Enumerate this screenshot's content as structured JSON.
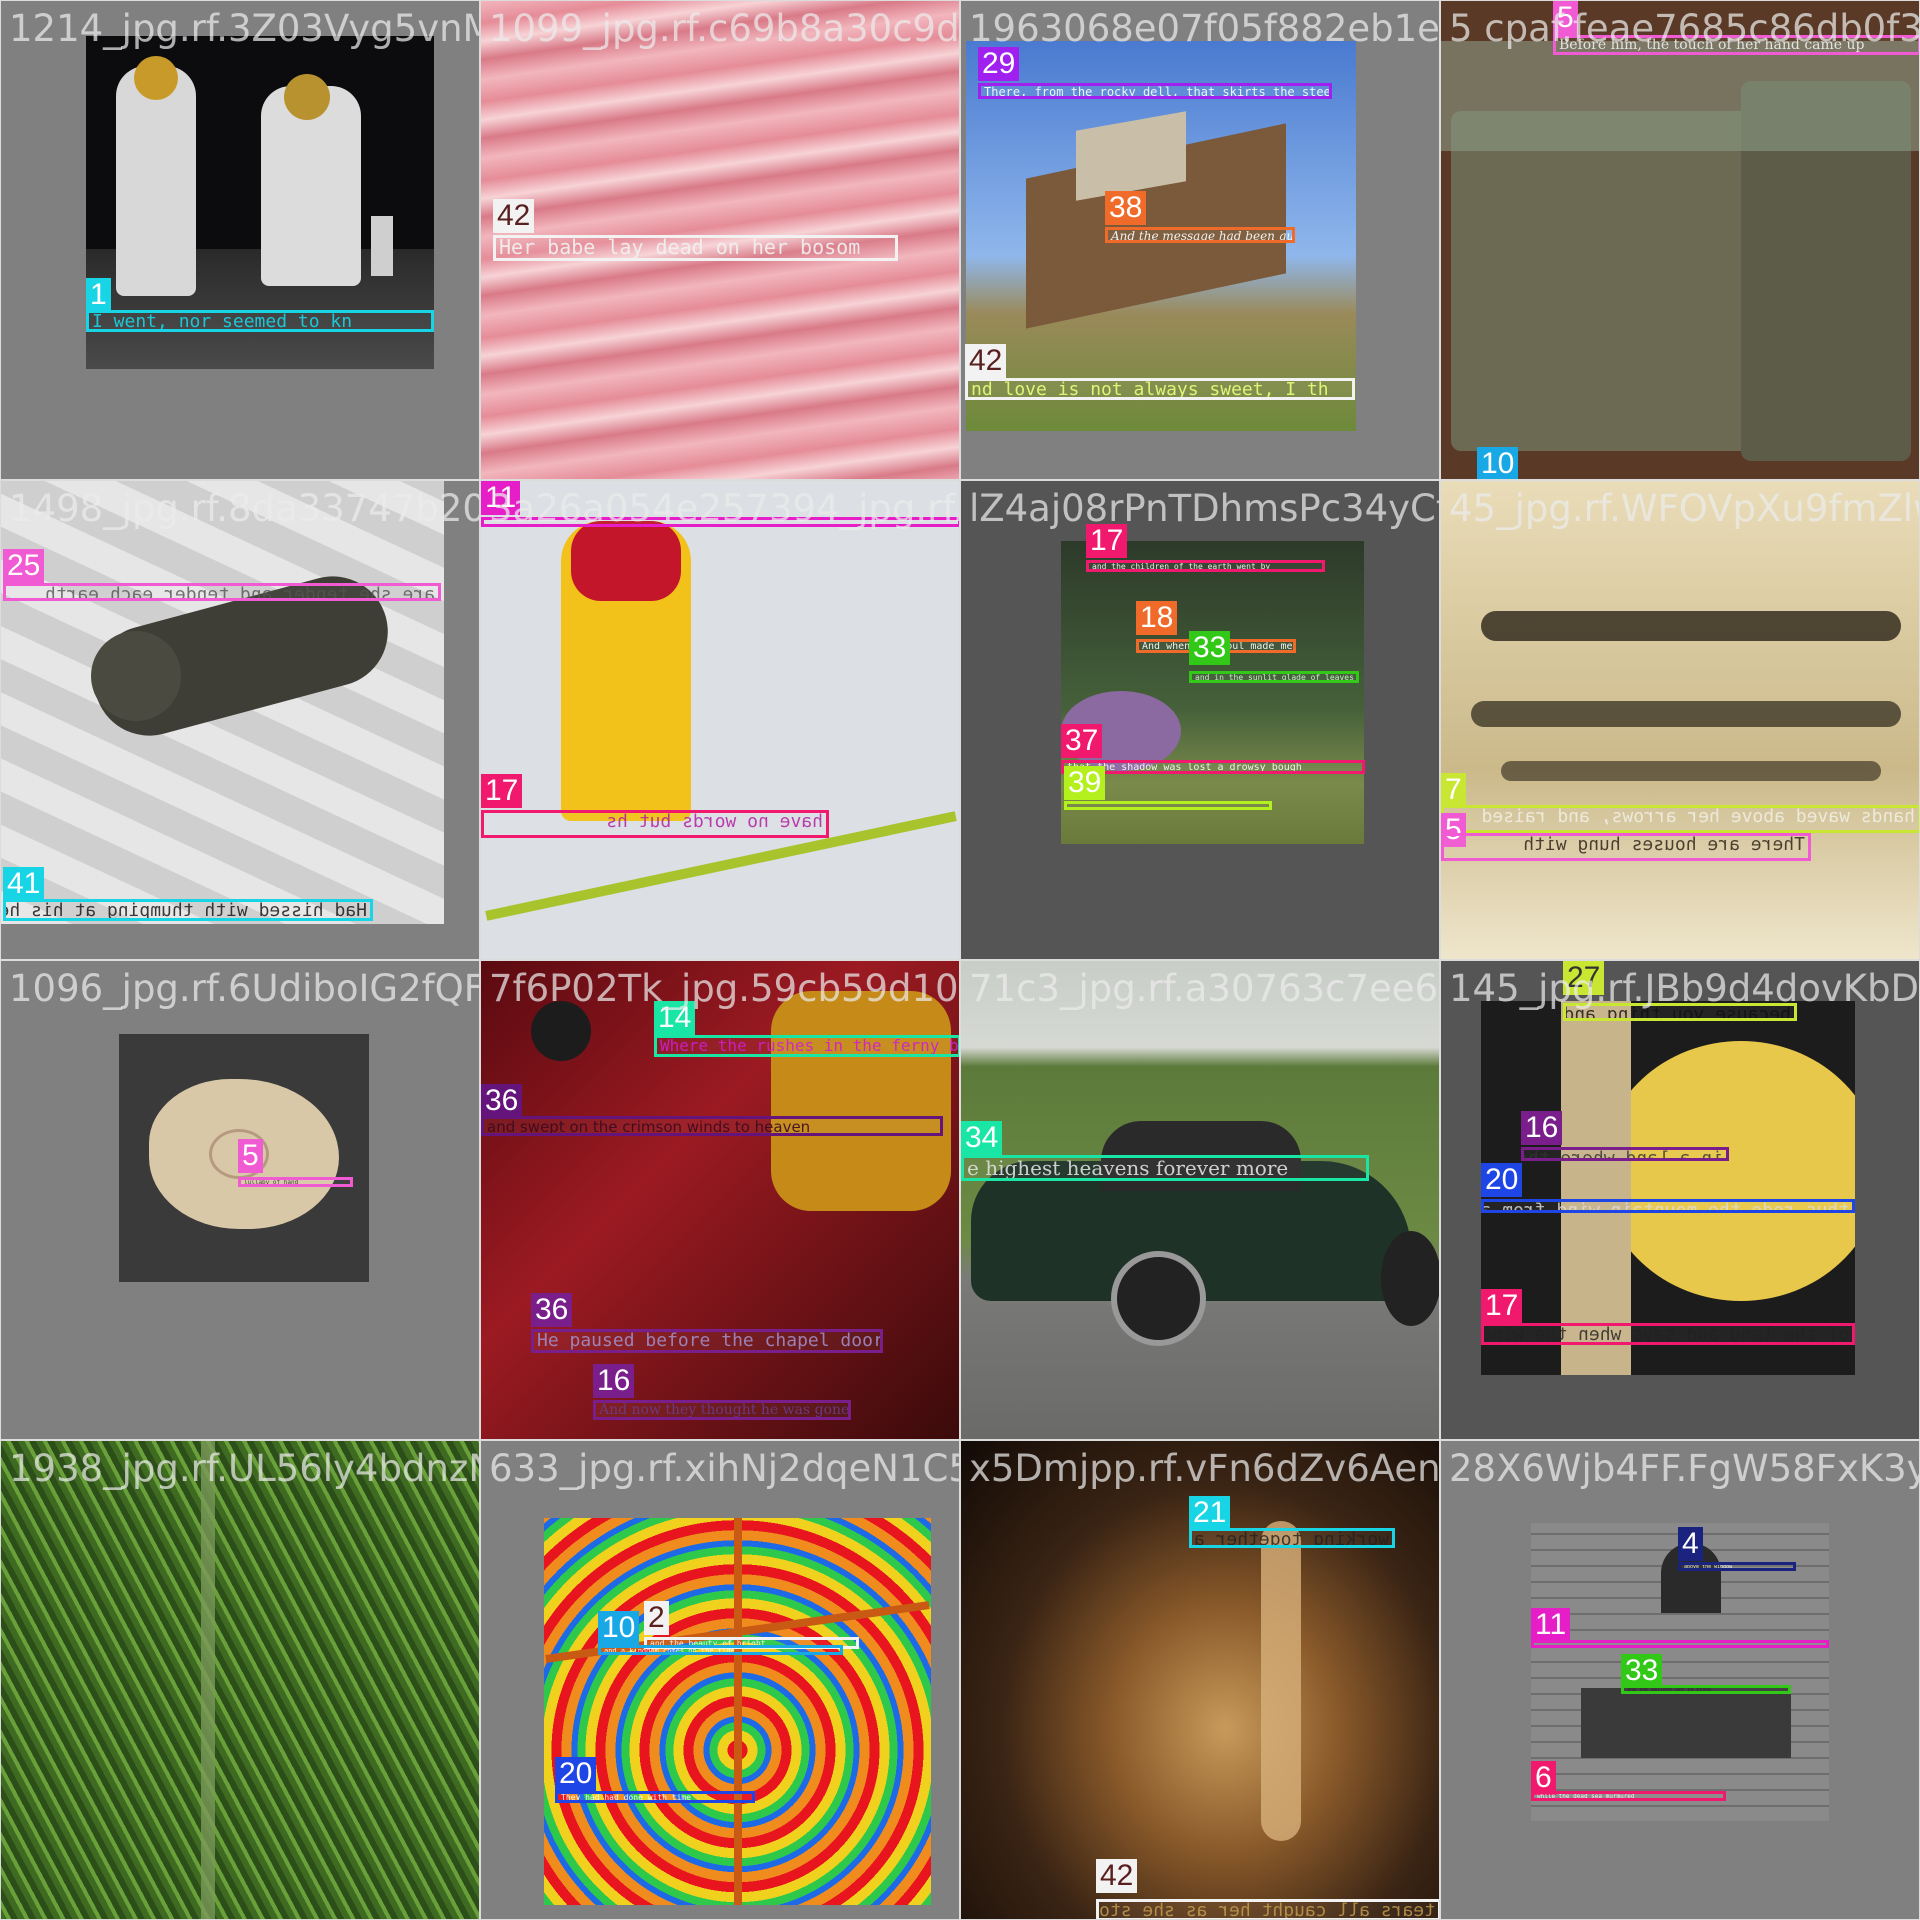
{
  "tiles": [
    {
      "filename": "1214_jpg.rf.3Z03Vyg5vnMOl0999Kipl_jpg",
      "labels": [
        {
          "id": "1",
          "color": "#18d5e6",
          "text": "I went, nor seemed to kn"
        }
      ]
    },
    {
      "filename": "1099_jpg.rf.c69b8a30c9dd0f1963068e07f05f882eb1ecf45c88",
      "labels": [
        {
          "id": "42",
          "color": "#f2f2f2",
          "tagText": "#5a1f1f",
          "text": "Her babe lay dead on her bosom"
        }
      ]
    },
    {
      "filename": "1963068e07f05f882eb1ecf45c88_jpg",
      "labels": [
        {
          "id": "29",
          "color": "#a020f0",
          "text": "There, from the rocky dell, that skirts the steep"
        },
        {
          "id": "38",
          "color": "#f06a2a",
          "text": "And the message had been quit"
        },
        {
          "id": "42",
          "color": "#f2f2f2",
          "tagText": "#5a1f1f",
          "text": "nd love is not always sweet, I th"
        }
      ]
    },
    {
      "filename": "5 cpaf.feae7685c86db0f3",
      "labels": [
        {
          "id": "5",
          "color": "#f05ad2",
          "text": "Before him, the touch of her hand came up"
        },
        {
          "id": "10",
          "color": "#19a8e6",
          "text": ""
        }
      ]
    },
    {
      "filename": "1498_jpg.rf.8da33747b2092a26a054e257394",
      "labels": [
        {
          "id": "25",
          "color": "#f05ad2",
          "text": "are she tender and tender each earth",
          "mirror": true
        },
        {
          "id": "41",
          "color": "#18d5e6",
          "text": "Had hissed with thumping at his heel",
          "mirror": true
        }
      ]
    },
    {
      "filename": "3a26a054e257394_jpg.rf.xmxT9UgzlZ4aj08rPnTDhmsPc34yCt",
      "labels": [
        {
          "id": "11",
          "color": "#e61ec8",
          "text": ""
        },
        {
          "id": "17",
          "color": "#f0196e",
          "text": "have no words but hs",
          "mirror": true
        }
      ]
    },
    {
      "filename": "lZ4aj08rPnTDhmsPc34yCt45tjg_jpg",
      "labels": [
        {
          "id": "17",
          "color": "#f0196e",
          "text": "and the children of the earth went by"
        },
        {
          "id": "18",
          "color": "#f06a2a",
          "text": "And when our soul made me"
        },
        {
          "id": "33",
          "color": "#32c818",
          "text": "and in the sunlit glade of leaves"
        },
        {
          "id": "37",
          "color": "#f0196e",
          "text": "that the shadow was lost a drowsy bough"
        },
        {
          "id": "39",
          "color": "#b4f01e",
          "text": ""
        }
      ]
    },
    {
      "filename": "45_jpg.rf.WFOVpXu9fmZlw9",
      "labels": [
        {
          "id": "7",
          "color": "#c8e632",
          "text": "hands waved above her arrows, and raised",
          "mirror": true
        },
        {
          "id": "5",
          "color": "#f05ad2",
          "text": "There are houses hung with",
          "mirror": true
        }
      ]
    },
    {
      "filename": "1096_jpg.rf.6UdiboIG2fQFX7f6P02Tk",
      "labels": [
        {
          "id": "5",
          "color": "#f05ad2",
          "text": "lullaby of hand"
        }
      ]
    },
    {
      "filename": "7f6P02Tk_jpg.59cb59d10ed15f71c3",
      "labels": [
        {
          "id": "14",
          "color": "#19e6a5",
          "text": "Where the rushes in the ferny bro"
        },
        {
          "id": "36",
          "color": "#64147a",
          "text": "and swept on the crimson winds to heaven"
        },
        {
          "id": "36",
          "color": "#7a1e8c",
          "text": "He paused before the chapel door"
        },
        {
          "id": "16",
          "color": "#7a1e8c",
          "text": "And now they thought he was gone"
        }
      ]
    },
    {
      "filename": "71c3_jpg.rf.a30763c7ee677befa1fc45a_jpg",
      "labels": [
        {
          "id": "34",
          "color": "#19e6a5",
          "text": "e highest heavens forever more"
        }
      ]
    },
    {
      "filename": "145_jpg.rf.JBb9d4dovKbDPYb8IF",
      "labels": [
        {
          "id": "27",
          "color": "#c8e632",
          "text": "because you thing and home again",
          "mirror": true
        },
        {
          "id": "16",
          "color": "#7a1e8c",
          "text": "in a land where the wind was",
          "mirror": true
        },
        {
          "id": "20",
          "color": "#1e46e6",
          "text": "thus rode the mountain wind from afar",
          "mirror": true
        },
        {
          "id": "17",
          "color": "#f0196e",
          "text": "of the land and says when the wind",
          "mirror": true
        }
      ]
    },
    {
      "filename": "1938_jpg.rf.UL56ly4bdnzNtV6lMjcGCf",
      "labels": []
    },
    {
      "filename": "633_jpg.rf.xihNj2dqeN1C5x5Dmjpp",
      "labels": [
        {
          "id": "2",
          "color": "#f2f2f2",
          "tagText": "#5a1f1f",
          "text": "and the beauty of bright"
        },
        {
          "id": "10",
          "color": "#19a8e6",
          "text": "and a kingdom comes on the tide"
        },
        {
          "id": "20",
          "color": "#1e46e6",
          "text": "They had had done with time"
        }
      ]
    },
    {
      "filename": "x5Dmjpp.rf.vFn6dZv6AenV28X6Wjb_jpg",
      "labels": [
        {
          "id": "21",
          "color": "#18d5e6",
          "text": "working together and",
          "mirror": true
        },
        {
          "id": "42",
          "color": "#f2f2f2",
          "tagText": "#5a1f1f",
          "text": "tears all caught her as she stood",
          "mirror": true
        }
      ]
    },
    {
      "filename": "28X6Wjb4FF.FgW58FxK3yHvD",
      "labels": [
        {
          "id": "4",
          "color": "#1a237e",
          "text": "above the window"
        },
        {
          "id": "11",
          "color": "#e61ec8",
          "text": ""
        },
        {
          "id": "33",
          "color": "#32c818",
          "text": "and the balcony set in stone"
        },
        {
          "id": "6",
          "color": "#f0196e",
          "text": "while the dead sea murmured"
        }
      ]
    }
  ]
}
